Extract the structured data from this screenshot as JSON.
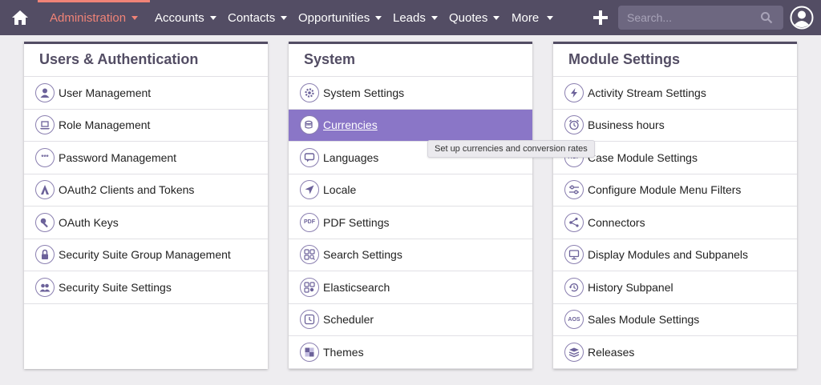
{
  "nav": {
    "items": [
      {
        "label": "Administration"
      },
      {
        "label": "Accounts"
      },
      {
        "label": "Contacts"
      },
      {
        "label": "Opportunities"
      },
      {
        "label": "Leads"
      },
      {
        "label": "Quotes"
      },
      {
        "label": "More"
      }
    ],
    "search_placeholder": "Search...",
    "accent_color": "#f08377",
    "bar_color": "#534d64"
  },
  "panels": [
    {
      "title": "Users & Authentication",
      "items": [
        {
          "label": "User Management",
          "icon": "user-icon"
        },
        {
          "label": "Role Management",
          "icon": "laptop-icon"
        },
        {
          "label": "Password Management",
          "icon": "password-icon"
        },
        {
          "label": "OAuth2 Clients and Tokens",
          "icon": "oauth2-icon"
        },
        {
          "label": "OAuth Keys",
          "icon": "key-icon"
        },
        {
          "label": "Security Suite Group Management",
          "icon": "lock-icon"
        },
        {
          "label": "Security Suite Settings",
          "icon": "group-icon"
        }
      ]
    },
    {
      "title": "System",
      "items": [
        {
          "label": "System Settings",
          "icon": "gear-icon"
        },
        {
          "label": "Currencies",
          "icon": "currency-icon",
          "selected": true
        },
        {
          "label": "Languages",
          "icon": "speech-bubble-icon"
        },
        {
          "label": "Locale",
          "icon": "location-arrow-icon"
        },
        {
          "label": "PDF Settings",
          "icon": "pdf-icon",
          "icon_text": "PDF"
        },
        {
          "label": "Search Settings",
          "icon": "search-settings-icon"
        },
        {
          "label": "Elasticsearch",
          "icon": "elasticsearch-icon"
        },
        {
          "label": "Scheduler",
          "icon": "clock-icon"
        },
        {
          "label": "Themes",
          "icon": "themes-icon"
        }
      ]
    },
    {
      "title": "Module Settings",
      "items": [
        {
          "label": "Activity Stream Settings",
          "icon": "lightning-icon"
        },
        {
          "label": "Business hours",
          "icon": "alarm-clock-icon"
        },
        {
          "label": "Case Module Settings",
          "icon": "aop-icon",
          "icon_text": "AOP"
        },
        {
          "label": "Configure Module Menu Filters",
          "icon": "sliders-icon"
        },
        {
          "label": "Connectors",
          "icon": "connectors-icon"
        },
        {
          "label": "Display Modules and Subpanels",
          "icon": "monitor-icon"
        },
        {
          "label": "History Subpanel",
          "icon": "history-icon"
        },
        {
          "label": "Sales Module Settings",
          "icon": "aos-icon",
          "icon_text": "AOS"
        },
        {
          "label": "Releases",
          "icon": "releases-icon"
        }
      ]
    }
  ],
  "tooltip": "Set up currencies and conversion rates",
  "selected_color": "#8a76c7"
}
